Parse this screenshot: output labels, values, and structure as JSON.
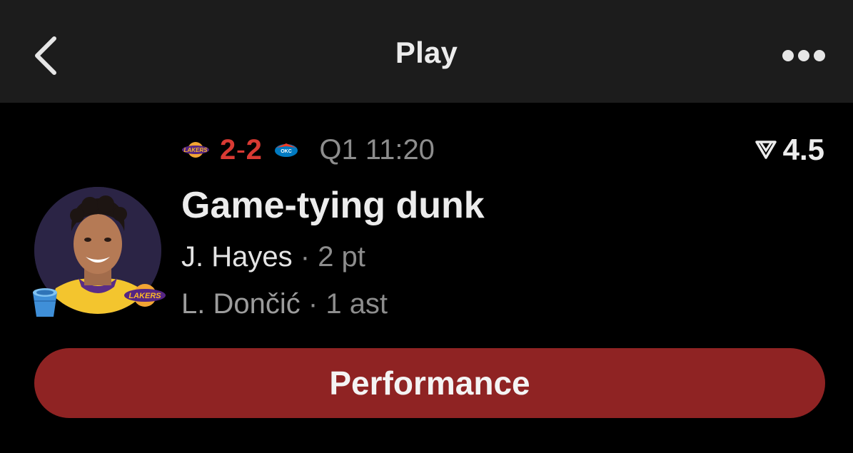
{
  "nav": {
    "title": "Play",
    "back_icon": "chevron-left-icon",
    "more_icon": "more-dots-icon"
  },
  "game": {
    "home_team_logo": "lakers-logo",
    "away_team_logo": "thunder-logo",
    "home_score": "2",
    "score_separator": "-",
    "away_score": "2",
    "clock": "Q1 11:20",
    "score_color": "#d93a33"
  },
  "rating": {
    "icon": "rating-icon",
    "value": "4.5"
  },
  "play": {
    "title": "Game-tying dunk",
    "primary_player": "J. Hayes",
    "primary_stat": "2 pt",
    "secondary_player": "L. Dončić",
    "secondary_stat": "1 ast",
    "separator": "·"
  },
  "avatar": {
    "badge_icon": "bucket-icon",
    "team_badge": "lakers-badge-icon"
  },
  "actions": {
    "performance_label": "Performance",
    "performance_color": "#8f2323"
  }
}
